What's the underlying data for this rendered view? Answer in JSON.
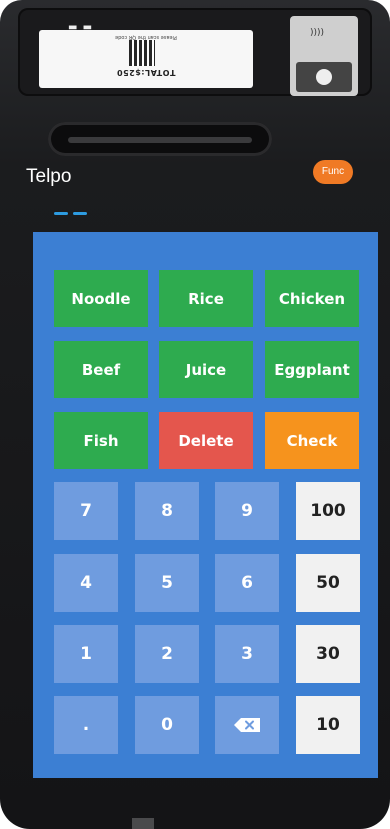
{
  "device": {
    "brand": "Telpo",
    "func_label": "Func",
    "customer_display": {
      "total_text": "TOTAL:$250",
      "scan_text": "Please scan the QR code"
    }
  },
  "products": [
    {
      "label": "Noodle"
    },
    {
      "label": "Rice"
    },
    {
      "label": "Chicken"
    },
    {
      "label": "Beef"
    },
    {
      "label": "Juice"
    },
    {
      "label": "Eggplant"
    },
    {
      "label": "Fish"
    }
  ],
  "actions": {
    "delete_label": "Delete",
    "check_label": "Check"
  },
  "keypad": {
    "digits": [
      "7",
      "8",
      "9",
      "4",
      "5",
      "6",
      "1",
      "2",
      "3",
      ".",
      "0"
    ],
    "backspace_icon": "backspace-icon"
  },
  "amounts": [
    "100",
    "50",
    "30",
    "10"
  ],
  "colors": {
    "screen_bg": "#3c7fd3",
    "product_green": "#2eab4f",
    "delete_red": "#e4564d",
    "check_orange": "#f6931d",
    "keypad_blue": "#6f9cdf",
    "amount_white": "#f1f1f1",
    "func_orange": "#f07a25"
  }
}
